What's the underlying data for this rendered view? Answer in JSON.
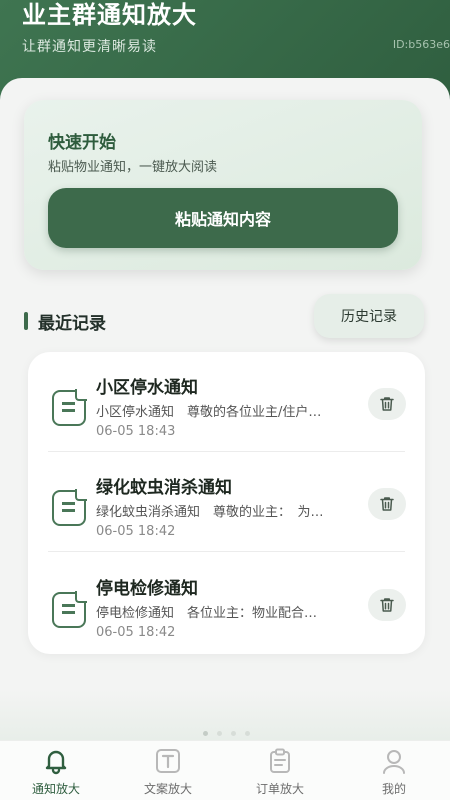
{
  "header": {
    "title": "业主群通知放大",
    "subtitle": "让群通知更清晰易读",
    "id_text": "ID:b563e6"
  },
  "quick_start": {
    "title": "快速开始",
    "description": "粘贴物业通知，一键放大阅读",
    "paste_button_label": "粘贴通知内容"
  },
  "recent": {
    "section_title": "最近记录",
    "history_button_label": "历史记录",
    "records": [
      {
        "title": "小区停水通知",
        "preview": "小区停水通知　尊敬的各位业主/住户…",
        "time": "06-05 18:43",
        "icon": "document-icon"
      },
      {
        "title": "绿化蚊虫消杀通知",
        "preview": "绿化蚊虫消杀通知　尊敬的业主：　为…",
        "time": "06-05 18:42",
        "icon": "document-icon"
      },
      {
        "title": "停电检修通知",
        "preview": "停电检修通知　各位业主：物业配合…",
        "time": "06-05 18:42",
        "icon": "document-icon"
      }
    ]
  },
  "tabbar": {
    "items": [
      {
        "label": "通知放大",
        "icon": "bell-icon",
        "active": true
      },
      {
        "label": "文案放大",
        "icon": "text-icon",
        "active": false
      },
      {
        "label": "订单放大",
        "icon": "clipboard-icon",
        "active": false
      },
      {
        "label": "我的",
        "icon": "user-icon",
        "active": false
      }
    ]
  },
  "colors": {
    "brand": "#3d6a4b",
    "header": "#356546",
    "card_bg": "#e3eee6"
  }
}
